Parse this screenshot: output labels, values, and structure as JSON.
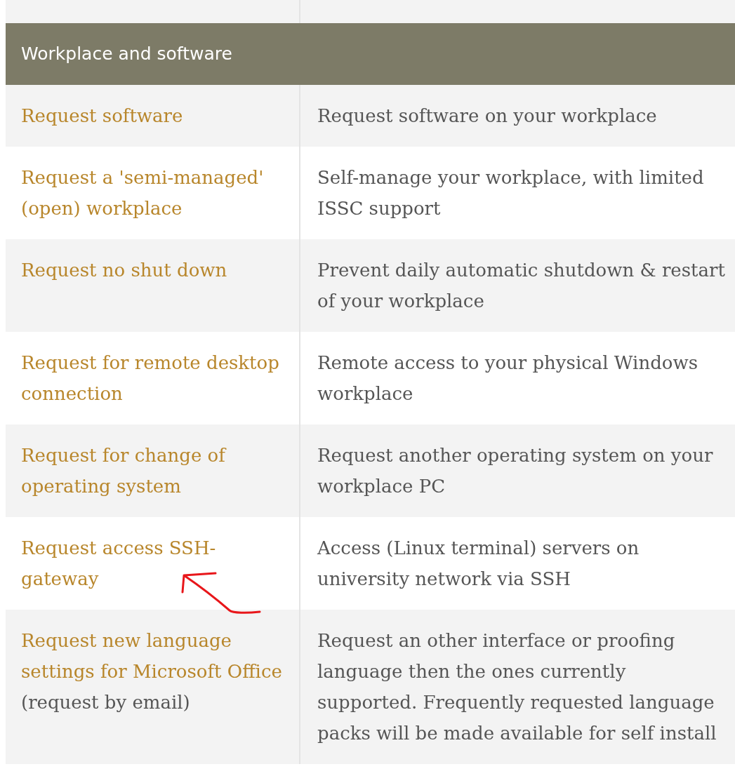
{
  "section": {
    "title": "Workplace and software"
  },
  "rows": [
    {
      "service": "Request software",
      "description": "Request software on your workplace"
    },
    {
      "service": "Request a 'semi-managed' (open) workplace",
      "description": "Self-manage your workplace, with limited ISSC support"
    },
    {
      "service": "Request no shut down",
      "description": "Prevent daily automatic shutdown & restart of your workplace"
    },
    {
      "service": "Request for remote desktop connection",
      "description": "Remote access to your physical Windows workplace"
    },
    {
      "service": "Request for change of operating system",
      "description": "Request another operating system on your workplace PC"
    },
    {
      "service": "Request access SSH-gateway",
      "description": "Access (Linux terminal) servers on university network via SSH"
    },
    {
      "service": "Request new language settings for Microsoft Office",
      "note": "(request by email)",
      "description": "Request an other interface or proofing language then the ones currently supported. Frequently requested language packs will be made available for self install"
    }
  ]
}
